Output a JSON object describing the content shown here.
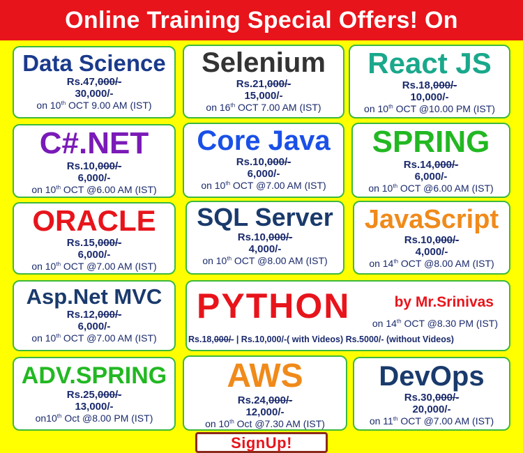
{
  "banner": {
    "text": "Online Training Special Offers! On"
  },
  "courses": [
    {
      "title": "Data Science",
      "old_price_prefix": "Rs.47,",
      "old_price_struck": "000/-",
      "new_price": "30,000/-",
      "sched_prefix": "on 10",
      "sched_sup": "th",
      "sched_rest": " OCT 9.00 AM (IST)",
      "color": "#1a3a8c"
    },
    {
      "title": "Selenium",
      "old_price_prefix": "Rs.21,",
      "old_price_struck": "000/-",
      "new_price": "15,000/-",
      "sched_prefix": "on 16",
      "sched_sup": "th",
      "sched_rest": " OCT 7.00 AM (IST)",
      "color": "#333333"
    },
    {
      "title": "React JS",
      "old_price_prefix": "Rs.18,",
      "old_price_struck": "000/-",
      "new_price": "10,000/-",
      "sched_prefix": "on 10",
      "sched_sup": "th",
      "sched_rest": " OCT @10.00 PM (IST)",
      "color": "#1aa88c"
    },
    {
      "title": "C#.NET",
      "old_price_prefix": "Rs.10,",
      "old_price_struck": "000/-",
      "new_price": "6,000/-",
      "sched_prefix": "on 10",
      "sched_sup": "th",
      "sched_rest": " OCT @6.00 AM (IST)",
      "color": "#7a1ab8"
    },
    {
      "title": "Core Java",
      "old_price_prefix": "Rs.10,",
      "old_price_struck": "000/-",
      "new_price": "6,000/-",
      "sched_prefix": "on 10",
      "sched_sup": "th",
      "sched_rest": " OCT @7.00 AM (IST)",
      "color": "#1a50e8"
    },
    {
      "title": "SPRING",
      "old_price_prefix": "Rs.14,",
      "old_price_struck": "000/-",
      "new_price": "6,000/-",
      "sched_prefix": "on 10",
      "sched_sup": "th",
      "sched_rest": " OCT @6.00 AM (IST)",
      "color": "#22b822"
    },
    {
      "title": "ORACLE",
      "old_price_prefix": "Rs.15,",
      "old_price_struck": "000/-",
      "new_price": "6,000/-",
      "sched_prefix": "on 10",
      "sched_sup": "th",
      "sched_rest": " OCT @7.00 AM (IST)",
      "color": "#e8141b"
    },
    {
      "title": "SQL Server",
      "old_price_prefix": "Rs.10,",
      "old_price_struck": "000/-",
      "new_price": "4,000/-",
      "sched_prefix": "on 10",
      "sched_sup": "th",
      "sched_rest": " OCT @8.00 AM (IST)",
      "color": "#1a3a6c"
    },
    {
      "title": "JavaScript",
      "old_price_prefix": "Rs.10,",
      "old_price_struck": "000/-",
      "new_price": "4,000/-",
      "sched_prefix": "on 14",
      "sched_sup": "th",
      "sched_rest": " OCT @8.00 AM (IST)",
      "color": "#f08a1a"
    },
    {
      "title": "Asp.Net MVC",
      "old_price_prefix": "Rs.12,",
      "old_price_struck": "000/-",
      "new_price": "6,000/-",
      "sched_prefix": "on 10",
      "sched_sup": "th",
      "sched_rest": " OCT @7.00 AM (IST)",
      "color": "#1a3a6c"
    },
    {
      "title": "ADV.SPRING",
      "old_price_prefix": "Rs.25,",
      "old_price_struck": "000/-",
      "new_price": "13,000/-",
      "sched_prefix": "on10",
      "sched_sup": "th",
      "sched_rest": " Oct @8.00 PM (IST)",
      "color": "#22b822"
    },
    {
      "title": "AWS",
      "old_price_prefix": "Rs.24,",
      "old_price_struck": "000/-",
      "new_price": "12,000/-",
      "sched_prefix": "on 10",
      "sched_sup": "th",
      "sched_rest": " Oct @7.30 AM (IST)",
      "color": "#f08a1a"
    },
    {
      "title": "DevOps",
      "old_price_prefix": "Rs.30,",
      "old_price_struck": "000/-",
      "new_price": "20,000/-",
      "sched_prefix": "on 11",
      "sched_sup": "th",
      "sched_rest": " OCT @7.00 AM (IST)",
      "color": "#1a3a6c"
    }
  ],
  "python": {
    "title": "PYTHON",
    "by": "by Mr.Srinivas",
    "sched_prefix": "on 14",
    "sched_sup": "th",
    "sched_rest": " OCT @8.30 PM (IST)",
    "price_prefix": "Rs.18,",
    "price_struck": "000/-",
    "price_rest": "  | Rs.10,000/-( with Videos) Rs.5000/- (without Videos)",
    "color": "#e8141b"
  },
  "signup": {
    "label": "SignUp!"
  }
}
